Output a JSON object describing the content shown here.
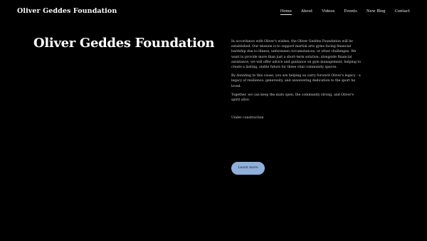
{
  "header": {
    "site_title": "Oliver Geddes Foundation",
    "nav": [
      {
        "label": "Home",
        "active": true
      },
      {
        "label": "About",
        "active": false
      },
      {
        "label": "Videos",
        "active": false
      },
      {
        "label": "Events",
        "active": false
      },
      {
        "label": "New Blog",
        "active": false
      },
      {
        "label": "Contact",
        "active": false
      }
    ]
  },
  "hero": {
    "title": "Oliver Geddes Foundation"
  },
  "content": {
    "paragraphs": [
      "In accordance with Oliver's wishes, the Oliver Geddes Foundation will be established. Our mission is to support martial arts gyms facing financial hardship due to illness, unforeseen circumstances, or other challenges. We want to provide more than just a short-term solution; alongside financial assistance, we will offer advice and guidance on gym management, helping to create a lasting, stable future for these vital community spaces.",
      "By donating to this cause, you are helping us carry forward Oliver's legacy - a legacy of resilience, generosity, and unwavering dedication to the sport he loved.",
      "Together, we can keep the mats open, the community strong, and Oliver's spirit alive."
    ],
    "construction_note": "Under construction",
    "button_label": "Learn more"
  },
  "colors": {
    "background": "#000000",
    "text": "#ffffff",
    "button_bg": "#8fb0da"
  }
}
